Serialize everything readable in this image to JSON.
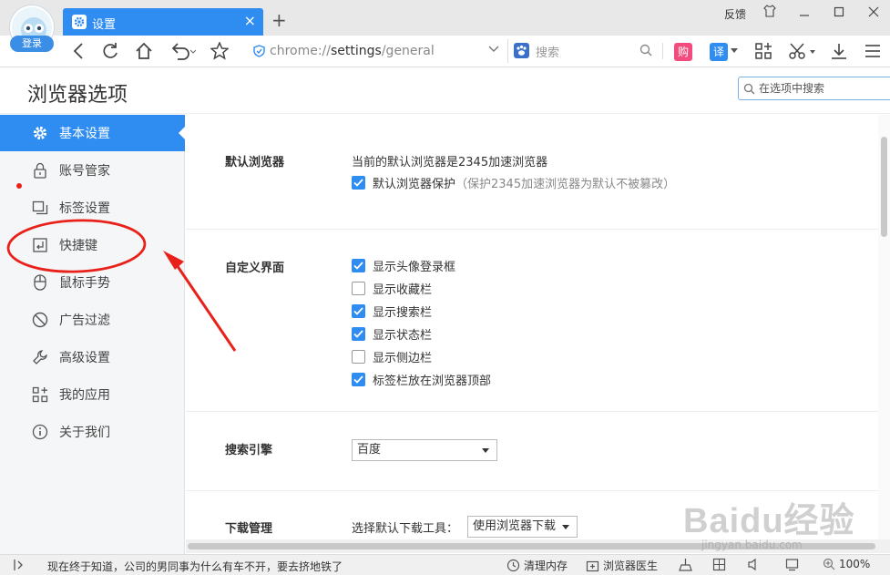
{
  "window": {
    "login_label": "登录",
    "tab_title": "设置",
    "new_tab": "+",
    "feedback": "反馈"
  },
  "toolbar": {
    "url_scheme": "chrome://",
    "url_host": "settings",
    "url_path": "/general",
    "search_placeholder": "搜索",
    "buy_label": "购",
    "translate_label": "译"
  },
  "header": {
    "title": "浏览器选项",
    "search_placeholder": "在选项中搜索"
  },
  "sidebar": {
    "items": [
      {
        "label": "基本设置",
        "icon": "gear-icon"
      },
      {
        "label": "账号管家",
        "icon": "lock-icon"
      },
      {
        "label": "标签设置",
        "icon": "tabs-icon"
      },
      {
        "label": "快捷键",
        "icon": "shortcut-icon"
      },
      {
        "label": "鼠标手势",
        "icon": "mouse-icon"
      },
      {
        "label": "广告过滤",
        "icon": "block-icon"
      },
      {
        "label": "高级设置",
        "icon": "wrench-icon"
      },
      {
        "label": "我的应用",
        "icon": "apps-icon"
      },
      {
        "label": "关于我们",
        "icon": "info-icon"
      }
    ],
    "active_index": 0
  },
  "main": {
    "default_browser": {
      "title": "默认浏览器",
      "status": "当前的默认浏览器是2345加速浏览器",
      "protect_label": "默认浏览器保护",
      "protect_hint": "（保护2345加速浏览器为默认不被篡改）",
      "protect_checked": true
    },
    "custom_ui": {
      "title": "自定义界面",
      "options": [
        {
          "label": "显示头像登录框",
          "checked": true
        },
        {
          "label": "显示收藏栏",
          "checked": false
        },
        {
          "label": "显示搜索栏",
          "checked": true
        },
        {
          "label": "显示状态栏",
          "checked": true
        },
        {
          "label": "显示侧边栏",
          "checked": false
        },
        {
          "label": "标签栏放在浏览器顶部",
          "checked": true
        }
      ]
    },
    "search_engine": {
      "title": "搜索引擎",
      "selected": "百度"
    },
    "download": {
      "title": "下载管理",
      "label": "选择默认下载工具：",
      "selected": "使用浏览器下载"
    }
  },
  "statusbar": {
    "news": "现在终于知道，公司的男同事为什么有车不开，要去挤地铁了",
    "clean_memory": "清理内存",
    "doctor": "浏览器医生",
    "zoom": "100%"
  },
  "watermark": {
    "brand": "Baidu经验",
    "url": "jingyan.baidu.com"
  },
  "colors": {
    "accent": "#2f8cf0",
    "annotation": "#e8221b"
  }
}
